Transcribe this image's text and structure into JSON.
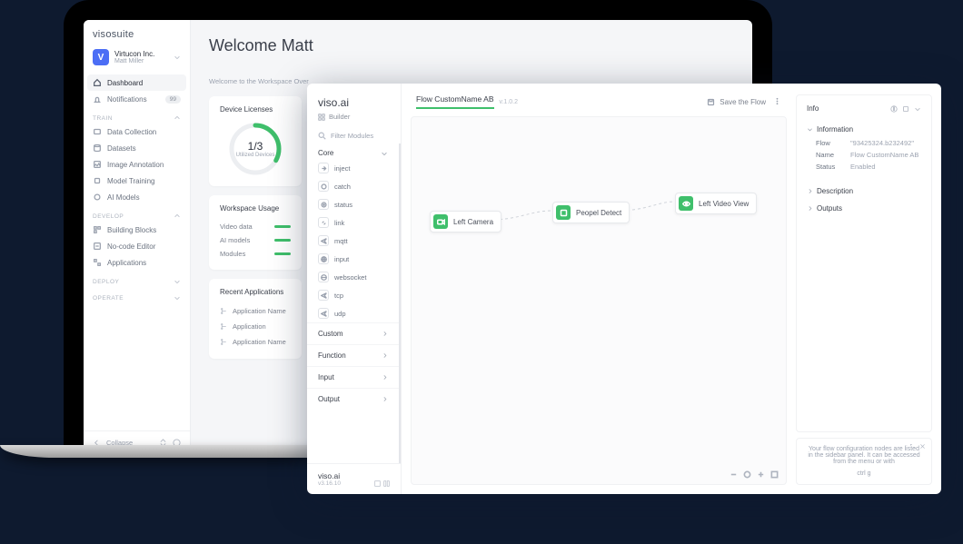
{
  "visosuite": {
    "logo": "visosuite",
    "org": {
      "badge": "V",
      "name": "Virtucon Inc.",
      "user": "Matt Miller"
    },
    "nav_top": [
      {
        "id": "dashboard",
        "label": "Dashboard",
        "active": true
      },
      {
        "id": "notifications",
        "label": "Notifications",
        "badge": "99"
      }
    ],
    "sections": [
      {
        "title": "TRAIN",
        "open": true,
        "items": [
          {
            "id": "data-collection",
            "label": "Data Collection"
          },
          {
            "id": "datasets",
            "label": "Datasets"
          },
          {
            "id": "image-annotation",
            "label": "Image Annotation"
          },
          {
            "id": "model-training",
            "label": "Model Training"
          },
          {
            "id": "ai-models",
            "label": "AI Models"
          }
        ]
      },
      {
        "title": "DEVELOP",
        "open": true,
        "items": [
          {
            "id": "building-blocks",
            "label": "Building Blocks"
          },
          {
            "id": "no-code-editor",
            "label": "No-code Editor"
          },
          {
            "id": "applications",
            "label": "Applications"
          }
        ]
      },
      {
        "title": "DEPLOY",
        "open": false,
        "items": []
      },
      {
        "title": "OPERATE",
        "open": false,
        "items": []
      }
    ],
    "collapse": "Collapse",
    "main": {
      "welcome": "Welcome Matt",
      "crumb": "Welcome to the Workspace Over",
      "device_card": {
        "title": "Device Licenses",
        "value": "1/3",
        "label": "Utilized\nDevices"
      },
      "usage_card": {
        "title": "Workspace Usage",
        "rows": [
          "Video data",
          "AI models",
          "Modules"
        ]
      },
      "recent_card": {
        "title": "Recent Applications",
        "rows": [
          "Application Name",
          "Application",
          "Application Name"
        ]
      }
    }
  },
  "flow": {
    "brand": "viso.ai",
    "mode": "Builder",
    "filter_ph": "Filter Modules",
    "palette": {
      "core_label": "Core",
      "core": [
        {
          "id": "inject",
          "label": "inject"
        },
        {
          "id": "catch",
          "label": "catch"
        },
        {
          "id": "status",
          "label": "status"
        },
        {
          "id": "link",
          "label": "link"
        },
        {
          "id": "mqtt",
          "label": "mqtt"
        },
        {
          "id": "input",
          "label": "input"
        },
        {
          "id": "websocket",
          "label": "websocket"
        },
        {
          "id": "tcp",
          "label": "tcp"
        },
        {
          "id": "udp",
          "label": "udp"
        }
      ],
      "groups": [
        "Custom",
        "Function",
        "Input",
        "Output"
      ]
    },
    "footer": {
      "brand": "viso.ai",
      "version": "v3.16.10"
    },
    "canvas": {
      "tab": "Flow CustomName AB",
      "version": "v.1.0.2",
      "save": "Save the Flow",
      "nodes": {
        "cam": "Left Camera",
        "det": "Peopel Detect",
        "view": "Left Video View"
      }
    },
    "info": {
      "title": "Info",
      "section_info": "Information",
      "kv": {
        "flow_k": "Flow",
        "flow_v": "\"93425324.b232492\"",
        "name_k": "Name",
        "name_v": "Flow CustomName AB",
        "status_k": "Status",
        "status_v": "Enabled"
      },
      "section_desc": "Description",
      "section_out": "Outputs",
      "hint": "Your flow configuration nodes are listed in the sidebar panel. It can be accessed from the menu or with",
      "kbd": "ctrl g"
    }
  }
}
